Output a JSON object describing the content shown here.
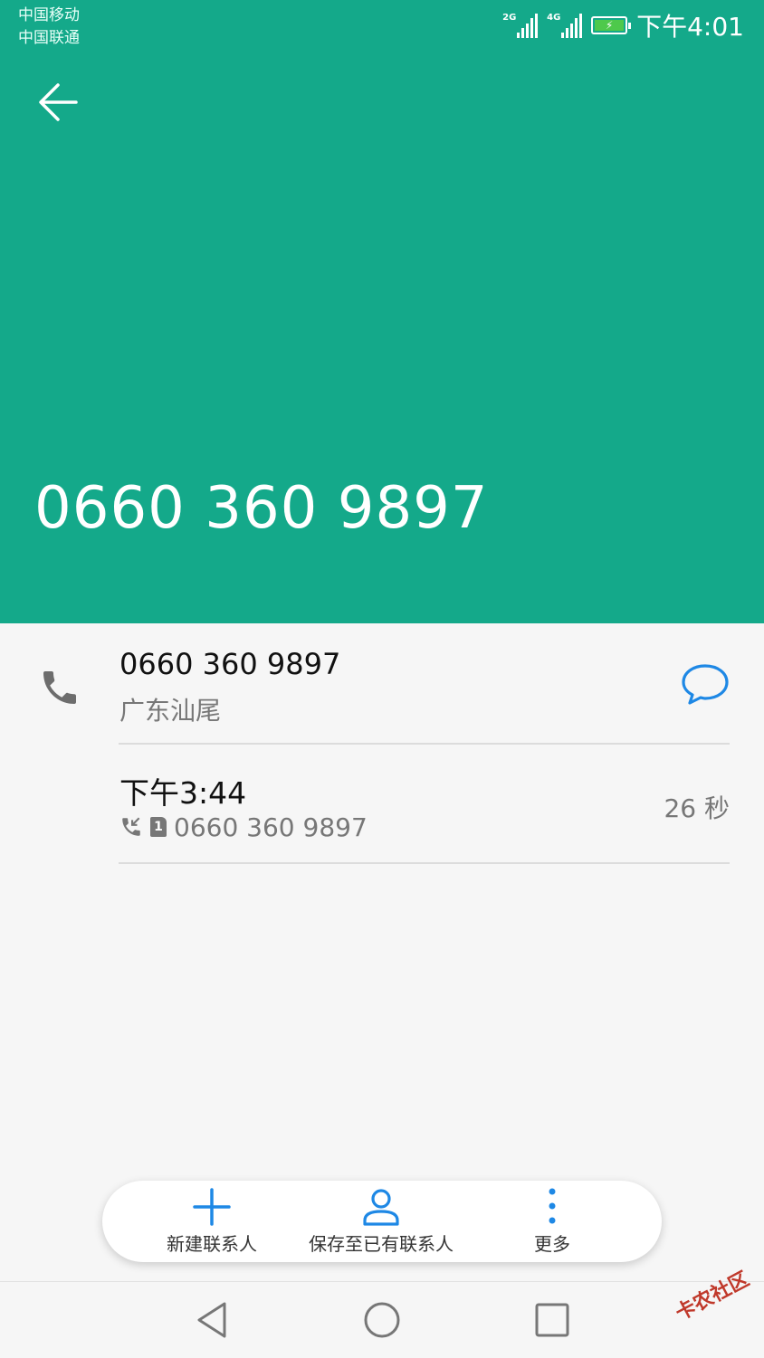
{
  "status_bar": {
    "carrier_1": "中国移动",
    "carrier_2": "中国联通",
    "sig1_gen": "2G",
    "sig2_gen": "4G",
    "time": "下午4:01"
  },
  "header": {
    "phone_number": "0660 360 9897",
    "background_color": "#14a98a"
  },
  "number_row": {
    "number": "0660 360 9897",
    "location": "广东汕尾"
  },
  "call_log": {
    "time": "下午3:44",
    "sim": "1",
    "number": "0660 360 9897",
    "duration": "26 秒"
  },
  "actions": {
    "new_contact": "新建联系人",
    "save_existing": "保存至已有联系人",
    "more": "更多"
  },
  "accent_color": "#1e88e5",
  "watermark": "卡农社区"
}
